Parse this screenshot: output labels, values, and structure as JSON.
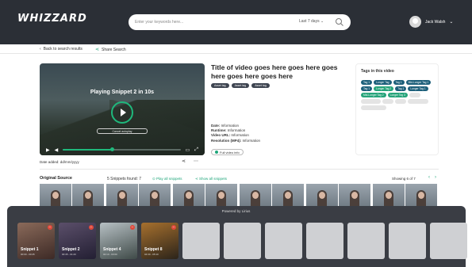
{
  "header": {
    "logo": "WHIZZARD",
    "search_placeholder": "Enter your keywords here...",
    "range": "Last 7 days",
    "range_chevron": "⌄",
    "user_name": "Jack Walsh",
    "user_chevron": "⌄"
  },
  "subbar": {
    "back": "Back to search results",
    "share": "Share Search"
  },
  "video": {
    "playing": "Playing Snippet 2 in 10s",
    "cancel": "Cancel autoplay",
    "progress": 0.42,
    "date_added": "Date added: dd/mm/yyyy"
  },
  "info": {
    "title": "Title of video goes here goes here goes here goes here goes here",
    "chips": [
      "Asset tag",
      "Asset tag",
      "Asset tag"
    ],
    "meta": [
      {
        "k": "Date:",
        "v": "Information"
      },
      {
        "k": "Runtime:",
        "v": "Information"
      },
      {
        "k": "Video URL:",
        "v": "Information"
      },
      {
        "k": "Resolution (MP4):",
        "v": "Information"
      }
    ],
    "full_info": "Full video info"
  },
  "tags": {
    "title": "Tags in this video",
    "items": [
      {
        "label": "Tag 1",
        "color": "#1c5f7a"
      },
      {
        "label": "Longer Tag",
        "color": "#1c5f7a"
      },
      {
        "label": "Tag 1",
        "color": "#1c5f7a"
      },
      {
        "label": "Mid-Longer Tag 1",
        "color": "#1c5f7a"
      },
      {
        "label": "Tag 1",
        "color": "#1c5f7a"
      },
      {
        "label": "Longer Tag 2",
        "color": "#26a47a"
      },
      {
        "label": "Tag 1",
        "color": "#1c5f7a"
      },
      {
        "label": "Longer Tag 1",
        "color": "#1c5f7a"
      },
      {
        "label": "Mid-Longer Tag 2",
        "color": "#26a47a"
      },
      {
        "label": "Longer Tag 3",
        "color": "#26a47a"
      },
      {
        "label": "Tag 1",
        "color": "#e4e4e4"
      },
      {
        "label": "Longer Tag 1",
        "color": "#e4e4e4"
      },
      {
        "label": "Tag 1",
        "color": "#e4e4e4"
      },
      {
        "label": "Tag 1",
        "color": "#e4e4e4"
      },
      {
        "label": "Longer Tag 1",
        "color": "#e4e4e4"
      },
      {
        "label": "Mid-Longer Tag 3",
        "color": "#e4e4e4"
      }
    ]
  },
  "source": {
    "title": "Original Source",
    "found": "5 Snippets found: 7",
    "play_all": "Play all snippets",
    "show_all": "Show all snippets",
    "showing": "Showing 6 of 7",
    "thumb_pairs": 6
  },
  "tray": {
    "powered": "Powered by Lirius",
    "snippets": [
      {
        "label": "Snippet 1",
        "time": "00:00 - 00:45",
        "bg": "linear-gradient(160deg,#8a6a5a,#3d2a26)"
      },
      {
        "label": "Snippet 2",
        "time": "00:45 - 01:20",
        "bg": "linear-gradient(160deg,#5b4f6a,#231f33)"
      },
      {
        "label": "Snippet 4",
        "time": "02:10 - 03:00",
        "bg": "linear-gradient(160deg,#b7c0c4,#3f4a48)"
      },
      {
        "label": "Snippet 8",
        "time": "04:30 - 05:10",
        "bg": "linear-gradient(160deg,#a6702e,#2c241a)"
      }
    ],
    "empty_slots": 7
  },
  "colors": {
    "accent": "#1fa67a",
    "header": "#2b2f36"
  }
}
